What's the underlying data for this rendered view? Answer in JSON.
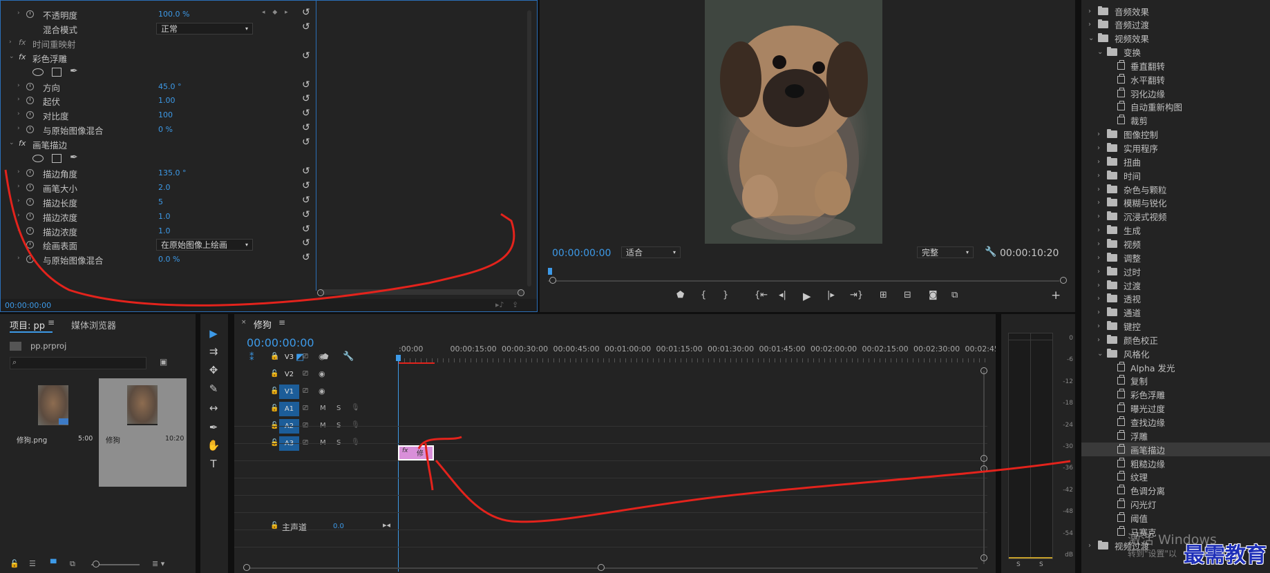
{
  "effect_controls": {
    "rows": [
      {
        "label": "不透明度",
        "value": "100.0 %",
        "type": "param"
      },
      {
        "label": "混合模式",
        "value": "正常",
        "type": "select"
      },
      {
        "label": "时间重映射",
        "type": "fx-disabled"
      },
      {
        "label": "彩色浮雕",
        "type": "fx"
      },
      {
        "type": "masks"
      },
      {
        "label": "方向",
        "value": "45.0 °",
        "type": "param"
      },
      {
        "label": "起伏",
        "value": "1.00",
        "type": "param"
      },
      {
        "label": "对比度",
        "value": "100",
        "type": "param"
      },
      {
        "label": "与原始图像混合",
        "value": "0 %",
        "type": "param"
      },
      {
        "label": "画笔描边",
        "type": "fx"
      },
      {
        "type": "masks"
      },
      {
        "label": "描边角度",
        "value": "135.0 °",
        "type": "param"
      },
      {
        "label": "画笔大小",
        "value": "2.0",
        "type": "param"
      },
      {
        "label": "描边长度",
        "value": "5",
        "type": "param"
      },
      {
        "label": "描边浓度",
        "value": "1.0",
        "type": "param"
      },
      {
        "label": "描边浓度",
        "value": "1.0",
        "type": "param"
      },
      {
        "label": "绘画表面",
        "value": "在原始图像上绘画",
        "type": "select"
      },
      {
        "label": "与原始图像混合",
        "value": "0.0 %",
        "type": "param"
      }
    ],
    "timecode": "00:00:00:00"
  },
  "program_monitor": {
    "timecode": "00:00:00:00",
    "fit": "适合",
    "quality": "完整",
    "duration": "00:00:10:20"
  },
  "project": {
    "tab_project": "项目: pp",
    "tab_media": "媒体浏览器",
    "file": "pp.prproj",
    "search_placeholder": "",
    "items": [
      {
        "name": "修狗.png",
        "duration": "5:00"
      },
      {
        "name": "修狗",
        "duration": "10:20"
      }
    ]
  },
  "timeline": {
    "tab": "修狗",
    "timecode": "00:00:00:00",
    "ruler": [
      ":00:00",
      "00:00:15:00",
      "00:00:30:00",
      "00:00:45:00",
      "00:01:00:00",
      "00:01:15:00",
      "00:01:30:00",
      "00:01:45:00",
      "00:02:00:00",
      "00:02:15:00",
      "00:02:30:00",
      "00:02:45:"
    ],
    "tracks": [
      {
        "name": "V3",
        "kind": "video"
      },
      {
        "name": "V2",
        "kind": "video"
      },
      {
        "name": "V1",
        "kind": "video",
        "active": true
      },
      {
        "name": "A1",
        "kind": "audio",
        "active": true
      },
      {
        "name": "A2",
        "kind": "audio",
        "active": true
      },
      {
        "name": "A3",
        "kind": "audio",
        "active": true
      }
    ],
    "master_label": "主声道",
    "master_value": "0.0",
    "clip_badge": "fx",
    "clip_label": "修"
  },
  "meter": {
    "scale": [
      "0",
      "-6",
      "-12",
      "-18",
      "-24",
      "-30",
      "-36",
      "-42",
      "-48",
      "-54",
      "dB"
    ],
    "solo": "S"
  },
  "effects_tree": {
    "items": [
      {
        "label": "音频效果",
        "level": 0,
        "icon": "folder",
        "open": false
      },
      {
        "label": "音频过渡",
        "level": 0,
        "icon": "folder",
        "open": false
      },
      {
        "label": "视频效果",
        "level": 0,
        "icon": "folder",
        "open": true
      },
      {
        "label": "变换",
        "level": 1,
        "icon": "folder",
        "open": true
      },
      {
        "label": "垂直翻转",
        "level": 2,
        "icon": "fx"
      },
      {
        "label": "水平翻转",
        "level": 2,
        "icon": "fx"
      },
      {
        "label": "羽化边缘",
        "level": 2,
        "icon": "fx"
      },
      {
        "label": "自动重新构图",
        "level": 2,
        "icon": "fx"
      },
      {
        "label": "裁剪",
        "level": 2,
        "icon": "fx"
      },
      {
        "label": "图像控制",
        "level": 1,
        "icon": "folder",
        "open": false
      },
      {
        "label": "实用程序",
        "level": 1,
        "icon": "folder",
        "open": false
      },
      {
        "label": "扭曲",
        "level": 1,
        "icon": "folder",
        "open": false
      },
      {
        "label": "时间",
        "level": 1,
        "icon": "folder",
        "open": false
      },
      {
        "label": "杂色与颗粒",
        "level": 1,
        "icon": "folder",
        "open": false
      },
      {
        "label": "模糊与锐化",
        "level": 1,
        "icon": "folder",
        "open": false
      },
      {
        "label": "沉浸式视频",
        "level": 1,
        "icon": "folder",
        "open": false
      },
      {
        "label": "生成",
        "level": 1,
        "icon": "folder",
        "open": false
      },
      {
        "label": "视频",
        "level": 1,
        "icon": "folder",
        "open": false
      },
      {
        "label": "调整",
        "level": 1,
        "icon": "folder",
        "open": false
      },
      {
        "label": "过时",
        "level": 1,
        "icon": "folder",
        "open": false
      },
      {
        "label": "过渡",
        "level": 1,
        "icon": "folder",
        "open": false
      },
      {
        "label": "透视",
        "level": 1,
        "icon": "folder",
        "open": false
      },
      {
        "label": "通道",
        "level": 1,
        "icon": "folder",
        "open": false
      },
      {
        "label": "键控",
        "level": 1,
        "icon": "folder",
        "open": false
      },
      {
        "label": "颜色校正",
        "level": 1,
        "icon": "folder",
        "open": false
      },
      {
        "label": "风格化",
        "level": 1,
        "icon": "folder",
        "open": true
      },
      {
        "label": "Alpha 发光",
        "level": 2,
        "icon": "fx"
      },
      {
        "label": "复制",
        "level": 2,
        "icon": "fx"
      },
      {
        "label": "彩色浮雕",
        "level": 2,
        "icon": "fx"
      },
      {
        "label": "曝光过度",
        "level": 2,
        "icon": "fx"
      },
      {
        "label": "查找边缘",
        "level": 2,
        "icon": "fx"
      },
      {
        "label": "浮雕",
        "level": 2,
        "icon": "fx"
      },
      {
        "label": "画笔描边",
        "level": 2,
        "icon": "fx",
        "selected": true
      },
      {
        "label": "粗糙边缘",
        "level": 2,
        "icon": "fx"
      },
      {
        "label": "纹理",
        "level": 2,
        "icon": "fx"
      },
      {
        "label": "色调分离",
        "level": 2,
        "icon": "fx"
      },
      {
        "label": "闪光灯",
        "level": 2,
        "icon": "fx"
      },
      {
        "label": "阈值",
        "level": 2,
        "icon": "fx"
      },
      {
        "label": "马赛克",
        "level": 2,
        "icon": "fx"
      },
      {
        "label": "视频过渡",
        "level": 0,
        "icon": "folder",
        "open": false
      }
    ]
  },
  "overlay": {
    "activate_title": "激活 Windows",
    "activate_sub": "转到\"设置\"以",
    "watermark": "最需教育"
  },
  "colors": {
    "accent": "#3d9ae8",
    "annotation": "#e3231c",
    "clip": "#d98fd9"
  }
}
